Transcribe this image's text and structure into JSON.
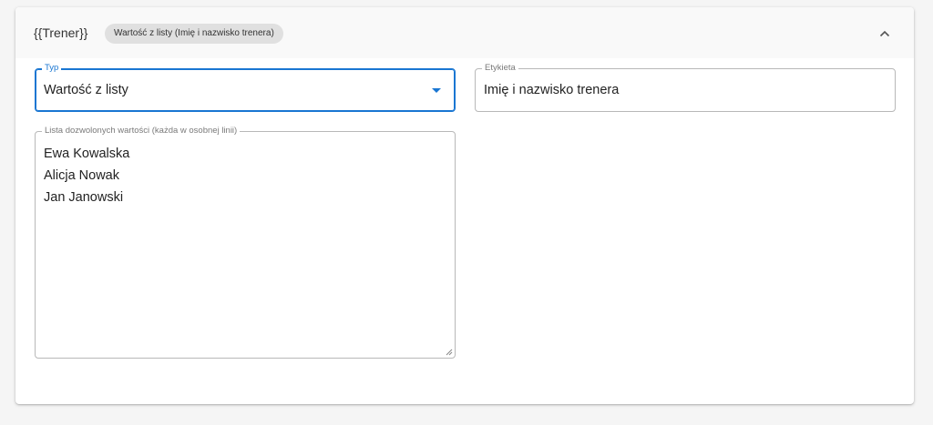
{
  "header": {
    "title": "{{Trener}}",
    "chip": "Wartość z listy (Imię i nazwisko trenera)",
    "collapse_icon": "chevron-up-icon"
  },
  "fields": {
    "type": {
      "label": "Typ",
      "value": "Wartość z listy",
      "icon": "caret-down-icon"
    },
    "label": {
      "label": "Etykieta",
      "value": "Imię i nazwisko trenera"
    },
    "allowed_values": {
      "label": "Lista dozwolonych wartości (każda w osobnej linii)",
      "lines": [
        "Ewa Kowalska",
        "Alicja Nowak",
        "Jan Janowski"
      ]
    }
  },
  "colors": {
    "accent": "#1976d2",
    "header_bg": "#f9f9f9",
    "chip_bg": "#e0e0e0",
    "page_bg": "#f5f5f5"
  }
}
